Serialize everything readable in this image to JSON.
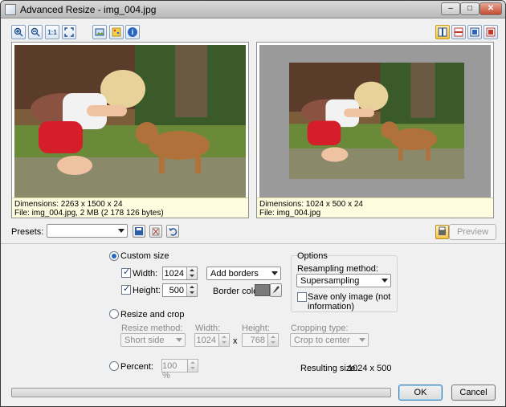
{
  "window": {
    "title": "Advanced Resize - img_004.jpg",
    "min_glyph": "–",
    "max_glyph": "□",
    "close_glyph": "✕"
  },
  "toolbar": {
    "left": [
      {
        "name": "zoom-in-icon"
      },
      {
        "name": "zoom-out-icon"
      },
      {
        "name": "actual-size-icon",
        "text": "1:1"
      },
      {
        "name": "fit-window-icon"
      },
      {
        "name": "show-info-icon"
      },
      {
        "name": "palette-icon"
      },
      {
        "name": "info-icon",
        "text": "i"
      }
    ],
    "right": [
      {
        "name": "side-by-side-layout-icon",
        "selected": true
      },
      {
        "name": "top-bottom-layout-icon"
      },
      {
        "name": "single-view-icon"
      },
      {
        "name": "split-view-icon"
      }
    ]
  },
  "original": {
    "dimensions": "Dimensions: 2263 x 1500 x 24",
    "file": "File: img_004.jpg, 2 MB (2 178 126 bytes)"
  },
  "result": {
    "dimensions": "Dimensions: 1024 x 500 x 24",
    "file": "File: img_004.jpg"
  },
  "presets": {
    "label": "Presets:",
    "value": "",
    "icons": [
      "save-preset-icon",
      "delete-preset-icon",
      "reset-preset-icon"
    ]
  },
  "preview": {
    "icon": "print-preview-icon",
    "label": "Preview"
  },
  "custom": {
    "label": "Custom size",
    "selected": true,
    "width_label": "Width:",
    "width": "1024",
    "width_checked": true,
    "height_label": "Height:",
    "height": "500",
    "height_checked": true,
    "mode": "Add borders",
    "border_color_label": "Border color:",
    "border_color": "#7a7a7a"
  },
  "options": {
    "title": "Options",
    "resampling_label": "Resampling method:",
    "resampling": "Supersampling",
    "save_only_label_1": "Save only image (not",
    "save_only_label_2": "information)",
    "save_only_checked": false
  },
  "crop": {
    "label": "Resize and crop",
    "selected": false,
    "method_label": "Resize method:",
    "method": "Short side",
    "width_label": "Width:",
    "width": "1024",
    "times": "x",
    "height_label": "Height:",
    "height": "768",
    "type_label": "Cropping type:",
    "type": "Crop to center"
  },
  "percent": {
    "label": "Percent:",
    "selected": false,
    "value": "100 %"
  },
  "resulting": {
    "label": "Resulting size:",
    "value": "1024 x 500"
  },
  "progress": {
    "value": 0
  },
  "buttons": {
    "ok": "OK",
    "cancel": "Cancel"
  },
  "colors": {
    "accent": "#3c7fb1",
    "info_bg": "#fffde0",
    "title_bar": "#c9c9c9"
  }
}
